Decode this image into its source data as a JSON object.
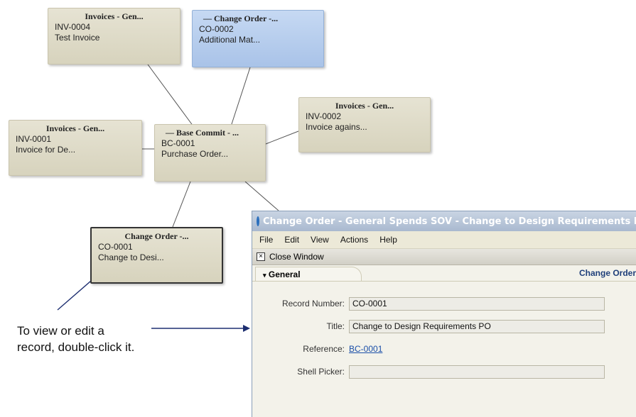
{
  "nodes": {
    "inv4": {
      "title": "Invoices - Gen...",
      "number": "INV-0004",
      "desc": "Test Invoice"
    },
    "co2": {
      "title": "Change Order -...",
      "number": "CO-0002",
      "desc": "Additional Mat..."
    },
    "inv1": {
      "title": "Invoices - Gen...",
      "number": "INV-0001",
      "desc": "Invoice for De..."
    },
    "base": {
      "title": "Base Commit - ...",
      "number": "BC-0001",
      "desc": "Purchase Order..."
    },
    "inv2": {
      "title": "Invoices - Gen...",
      "number": "INV-0002",
      "desc": "Invoice agains..."
    },
    "co1": {
      "title": "Change Order -...",
      "number": "CO-0001",
      "desc": "Change to Desi..."
    }
  },
  "annotation": {
    "line1": "To view or edit a",
    "line2": "record, double-click it."
  },
  "window": {
    "title": "Change Order - General Spends SOV - Change to Design Requirements PO",
    "menu": [
      "File",
      "Edit",
      "View",
      "Actions",
      "Help"
    ],
    "close_label": "Close Window",
    "tab_label": "General",
    "tab_right": "Change Order",
    "fields": {
      "record_number": {
        "label": "Record Number:",
        "value": "CO-0001"
      },
      "title": {
        "label": "Title:",
        "value": "Change to Design Requirements PO"
      },
      "reference": {
        "label": "Reference:",
        "value": "BC-0001"
      },
      "shell_picker": {
        "label": "Shell Picker:",
        "value": ""
      }
    }
  }
}
